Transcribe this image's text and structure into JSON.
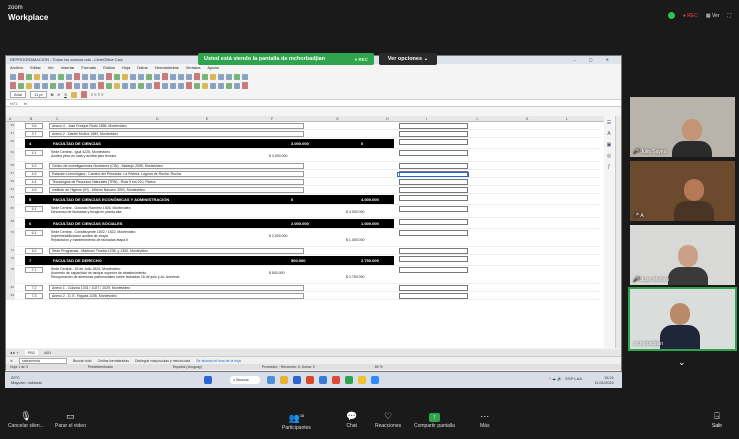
{
  "zoom": {
    "brand_small": "zoom",
    "brand": "Workplace",
    "rec_label": "REC",
    "view_label": "Ver"
  },
  "banner": {
    "text": "Usted está viendo la pantalla de mchorbadjian",
    "stop": "REC",
    "options": "Ver opciones"
  },
  "lo": {
    "title": "REPROGRAMACION - Todos los anexos.ods - LibreOffice Calc",
    "menu": [
      "Archivo",
      "Editar",
      "Ver",
      "Insertar",
      "Formato",
      "Estilos",
      "Hoja",
      "Datos",
      "Herramientas",
      "Ventana",
      "Ayuda"
    ],
    "font": "Arial",
    "size": "11 pt",
    "cellref": "H71",
    "formula": "fx",
    "col_letters": [
      "A",
      "B",
      "C",
      "D",
      "E",
      "F",
      "G",
      "H",
      "I",
      "J",
      "K",
      "L"
    ],
    "rows": [
      {
        "type": "item",
        "rn": "45",
        "code": "3.6",
        "desc": "Anexo 4 - José Enrique Rodó 1856, Montevideo"
      },
      {
        "type": "item",
        "rn": "47",
        "code": "3.7",
        "desc": "Anexo 2 - Daniel Muñoz 1982, Montevideo"
      },
      {
        "type": "head",
        "rn": "50",
        "code": "4",
        "desc": "FACULTAD DE CIENCIAS",
        "a": "3.000.000",
        "b": "0"
      },
      {
        "type": "item2",
        "rn": "52",
        "code": "4.1",
        "desc": "Sede Central - Iguá 4225, Montevideo",
        "desc2": "Azotea yeso en sala y azotea piso técnico",
        "v1": "$ 3.000.000"
      },
      {
        "type": "item",
        "rn": "55",
        "code": "4.2",
        "desc": "Centro de Investigaciones Nucleares (CIN) - Mataojo 2055, Montevideo"
      },
      {
        "type": "item",
        "rn": "57",
        "code": "4.3",
        "desc": "Estación Limnológica - Camino del Pescador, La Riviera, Laguna de Rocha, Rocha"
      },
      {
        "type": "item",
        "rn": "59",
        "code": "4.4",
        "desc": "Tecnológica de Recursos Naturales (TRN) - Ruta 9 km 210, Rivera"
      },
      {
        "type": "item",
        "rn": "61",
        "code": "4.5",
        "desc": "Instituto de Higiene (IH) - Alfredo Navarro 3051, Montevideo"
      },
      {
        "type": "head",
        "rn": "63",
        "code": "5",
        "desc": "FACULTAD DE CIENCIAS ECONÓMICAS Y ADMINISTRACIÓN",
        "a": "0",
        "b": "4.000.000"
      },
      {
        "type": "item2",
        "rn": "65",
        "code": "5.1",
        "desc": "Sede Central - Gonzalo Ramírez 1926, Montevideo",
        "desc2": "Descenso de fachadas y bicaja en planta alta",
        "v2": "$ 4.000.000"
      },
      {
        "type": "head",
        "rn": "68",
        "code": "6",
        "desc": "FACULTAD DE CIENCIAS SOCIALES",
        "a": "2.000.000",
        "b": "1.000.000"
      },
      {
        "type": "item3",
        "rn": "70",
        "code": "6.1",
        "desc": "Sede Central - Constituyente 1502 / 1522, Montevideo",
        "desc2": "Impermeabilización azotea de chapa",
        "desc3": "Reparación y mantenimiento de fachadas etapa II",
        "v1": "$ 2.000.000",
        "v2": "$ 1.000.000"
      },
      {
        "type": "item",
        "rn": "74",
        "code": "6.2",
        "desc": "Sede Programas - Martínez Trueba 1236, y 1300, Montevideo"
      },
      {
        "type": "head",
        "rn": "76",
        "code": "7",
        "desc": "FACULTAD DE DERECHO",
        "a": "500.000",
        "b": "2.750.000"
      },
      {
        "type": "item3",
        "rn": "78",
        "code": "7.1",
        "desc": "Sede Central - 18 de Julio 1824, Montevideo",
        "desc2": "Aumento de capacidad de tanque superior de abastecimiento",
        "desc3": "Recuperación de aberturas patrimoniales sobre fachadas 18 de julio y Av. Acevedo",
        "v1": "$ 500.000",
        "v2": "$ 2.750.000"
      },
      {
        "type": "item",
        "rn": "82",
        "code": "7.2",
        "desc": "Anexo 1 - Colonia 1031 / 1027 / 1029, Montevideo"
      },
      {
        "type": "item",
        "rn": "84",
        "code": "7.3",
        "desc": "Anexo 2 - D. E. Fagúas 1155, Montevideo"
      }
    ],
    "sheet_tabs": [
      "PB2",
      "A01"
    ],
    "find": {
      "value": "saleamenta",
      "opts": [
        "Buscar todo",
        "Celdas formateadas",
        "Distinguir mayúsculas y minúsculas"
      ],
      "found": "Se alcanzó el final de la hoja"
    },
    "status": [
      "Hoja 1 de 3",
      "Predeterminado",
      "Español (Uruguay)",
      "Promedio: ; Recuento: 0; Suma: 0",
      "65 %"
    ]
  },
  "taskbar": {
    "weather": "29°C",
    "weather2": "Mayorm. nublado",
    "search": "Buscar",
    "lang": "ESP LAA",
    "time": "15:21",
    "date": "11/11/2021"
  },
  "participants": [
    {
      "name": "Julio Sayes"
    },
    {
      "name": "A"
    },
    {
      "name": "Juan Merlino"
    },
    {
      "name": "mchorbadjian"
    }
  ],
  "bottom": {
    "audio": "Cancelar silen...",
    "video": "Parar el video",
    "participants": "Participantes",
    "count": "16",
    "chat": "Chat",
    "reactions": "Reacciones",
    "share": "Compartir pantalla",
    "more": "Más",
    "leave": "Salir"
  },
  "colors": {
    "zoom_green": "#2fa34d",
    "zoom_bg": "#1a1a1a",
    "header_row": "#000000"
  }
}
